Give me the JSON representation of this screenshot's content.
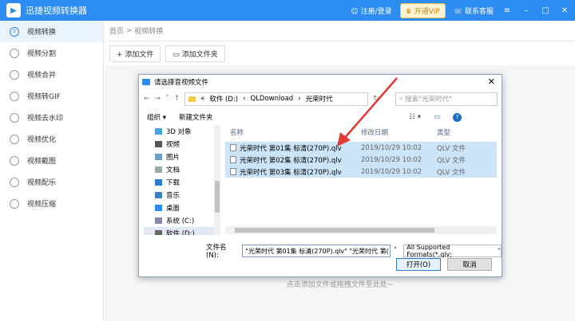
{
  "app": {
    "title": "迅捷视频转换器",
    "login": "注册/登录",
    "vip": "开通VIP",
    "support": "联系客服",
    "accent": "#2d8cf0"
  },
  "sidebar": {
    "items": [
      {
        "label": "视频转换",
        "icon": "convert-icon",
        "active": true
      },
      {
        "label": "视频分割",
        "icon": "split-icon"
      },
      {
        "label": "视频合并",
        "icon": "merge-icon"
      },
      {
        "label": "视频转GIF",
        "icon": "gif-icon"
      },
      {
        "label": "视频去水印",
        "icon": "watermark-icon"
      },
      {
        "label": "视频优化",
        "icon": "optimize-icon"
      },
      {
        "label": "视频截图",
        "icon": "screenshot-icon"
      },
      {
        "label": "视频配乐",
        "icon": "music-icon"
      },
      {
        "label": "视频压缩",
        "icon": "compress-icon"
      }
    ]
  },
  "breadcrumb": {
    "home": "首页",
    "sep": ">",
    "current": "视频转换"
  },
  "toolbar": {
    "add_file": "添加文件",
    "add_folder": "添加文件夹"
  },
  "main": {
    "hint": "点击添加文件或拖拽文件至此处~"
  },
  "dialog": {
    "title": "请选择音视频文件",
    "path": [
      "软件 (D:)",
      "QLDownload",
      "光荣时代"
    ],
    "search_placeholder": "搜索\"光荣时代\"",
    "organize": "组织 ▾",
    "new_folder": "新建文件夹",
    "nav": [
      "3D 对象",
      "视频",
      "图片",
      "文档",
      "下载",
      "音乐",
      "桌面",
      "系统 (C:)",
      "软件 (D:)"
    ],
    "columns": {
      "name": "名称",
      "date": "修改日期",
      "type": "类型"
    },
    "files": [
      {
        "name": "光荣时代 第01集 标清(270P).qlv",
        "date": "2019/10/29 10:02",
        "type": "QLV 文件"
      },
      {
        "name": "光荣时代 第02集 标清(270P).qlv",
        "date": "2019/10/29 10:02",
        "type": "QLV 文件"
      },
      {
        "name": "光荣时代 第03集 标清(270P).qlv",
        "date": "2019/10/29 10:02",
        "type": "QLV 文件"
      }
    ],
    "filename_label": "文件名(N):",
    "filename_value": "\"光荣时代 第01集 标清(270P).qlv\" \"光荣时代 第(",
    "filter": "All Supported Formats(*.qlv;",
    "open": "打开(O)",
    "cancel": "取消"
  }
}
